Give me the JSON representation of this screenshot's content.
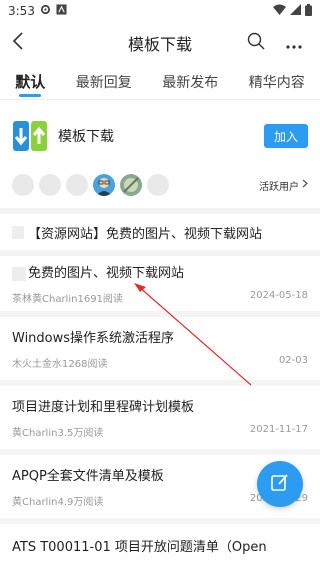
{
  "status_bar": {
    "time": "3:53"
  },
  "header": {
    "title": "模板下载",
    "back_icon": "chevron-left-icon",
    "search_icon": "search-icon",
    "more_icon": "more-dots-icon"
  },
  "tabs": [
    {
      "label": "默认",
      "active": true
    },
    {
      "label": "最新回复",
      "active": false
    },
    {
      "label": "最新发布",
      "active": false
    },
    {
      "label": "精华内容",
      "active": false
    }
  ],
  "forum": {
    "name": "模板下载",
    "join_label": "加入",
    "active_users_label": "活跃用户"
  },
  "pinned": {
    "title": "【资源网站】免费的图片、视频下载网站"
  },
  "posts": [
    {
      "title": "免费的图片、视频下载网站",
      "author": "茶林黄Charlin",
      "reads": "1691阅读",
      "date": "2024-05-18"
    },
    {
      "title": "Windows操作系统激活程序",
      "author": "木火土金水",
      "reads": "1268阅读",
      "date": "02-03"
    },
    {
      "title": "项目进度计划和里程碑计划模板",
      "author": "黄Charlin",
      "reads": "3.5万阅读",
      "date": "2021-11-17"
    },
    {
      "title": "APQP全套文件清单及模板",
      "author": "黄Charlin",
      "reads": "4.9万阅读",
      "date": "2021-03-29"
    },
    {
      "title": "ATS T00011-01 项目开放问题清单（Open",
      "author": "",
      "reads": "",
      "date": ""
    }
  ],
  "colors": {
    "accent": "#2b9cf2",
    "annotation_arrow": "#d9322b"
  }
}
